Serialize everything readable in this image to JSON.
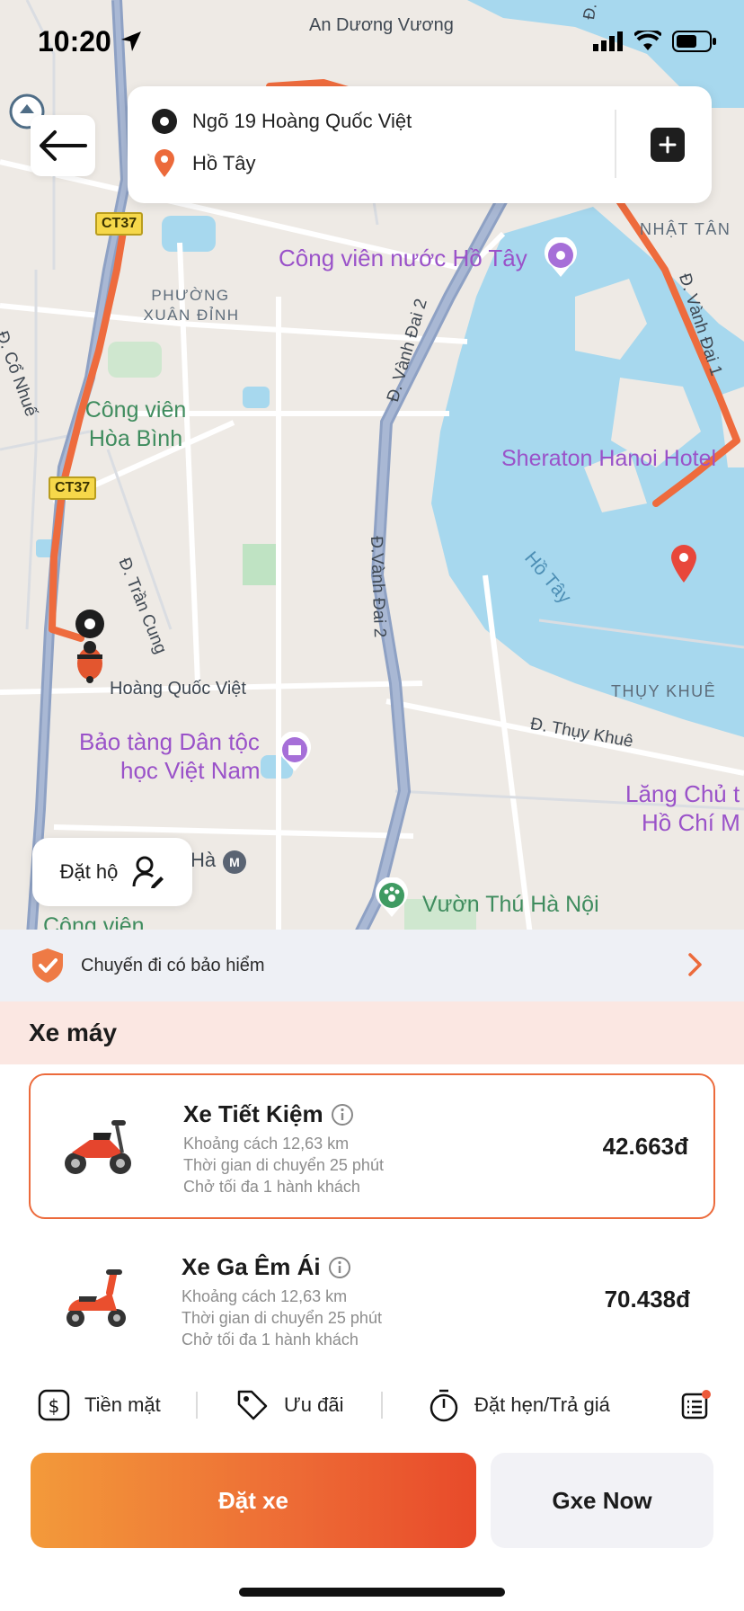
{
  "status_bar": {
    "time": "10:20"
  },
  "route": {
    "from": "Ngõ 19 Hoàng Quốc Việt",
    "to": "Hồ Tây"
  },
  "map": {
    "labels": {
      "an_duong_vuong": "An Dương Vương",
      "nhat_tan": "NHẬT TÂN",
      "cong_vien_nuoc": "Công viên nước Hồ Tây",
      "phuong_xuan_dinh_1": "PHƯỜNG",
      "phuong_xuan_dinh_2": "XUÂN ĐỈNH",
      "co_nhue": "Đ. Cổ Nhuế",
      "cong_vien_hoa_binh_1": "Công viên",
      "cong_vien_hoa_binh_2": "Hòa Bình",
      "vanh_dai_2_top": "Đ. Vành Đai 2",
      "vanh_dai_1": "Đ. Vành Đai 1",
      "sheraton": "Sheraton Hanoi Hotel",
      "ho_tay": "Hồ Tây",
      "tran_cung": "Đ. Trần Cung",
      "vanh_dai_2_mid": "Đ.Vành Đai 2",
      "hoang_quoc_viet": "Hoàng Quốc Việt",
      "thuy_khue_district": "THỤY KHUÊ",
      "thuy_khue_road": "Đ. Thụy Khuê",
      "bao_tang_1": "Bảo tàng Dân tộc",
      "bao_tang_2": "học Việt Nam",
      "lang_1": "Lăng Chủ t",
      "lang_2": "Hồ Chí M",
      "vuon_thu": "Vườn Thú Hà Nội",
      "ha_partial": "Hà",
      "cong_vien_bottom": "Công viên",
      "vanh_dai_top_right": "Đ. Vành",
      "shield_ct37_a": "CT37",
      "shield_ct37_b": "CT37",
      "metro": "M"
    }
  },
  "dat_ho": {
    "label": "Đặt hộ"
  },
  "insurance": {
    "label": "Chuyến đi có bảo hiểm"
  },
  "section": {
    "title": "Xe máy"
  },
  "rides": [
    {
      "name": "Xe Tiết Kiệm",
      "distance": "Khoảng cách 12,63 km",
      "duration": "Thời gian di chuyển 25 phút",
      "capacity": "Chở tối đa 1 hành khách",
      "price": "42.663đ",
      "selected": true
    },
    {
      "name": "Xe Ga Êm Ái",
      "distance": "Khoảng cách 12,63 km",
      "duration": "Thời gian di chuyển 25 phút",
      "capacity": "Chở tối đa 1 hành khách",
      "price": "70.438đ",
      "selected": false
    }
  ],
  "options": {
    "payment": "Tiền mặt",
    "promo": "Ưu đãi",
    "schedule": "Đặt hẹn/Trả giá"
  },
  "actions": {
    "book": "Đặt xe",
    "now": "Gxe Now"
  },
  "colors": {
    "accent": "#ED6A35",
    "route": "#EE6B3D",
    "water": "#A7D8EE",
    "poi": "#9A52C9"
  }
}
